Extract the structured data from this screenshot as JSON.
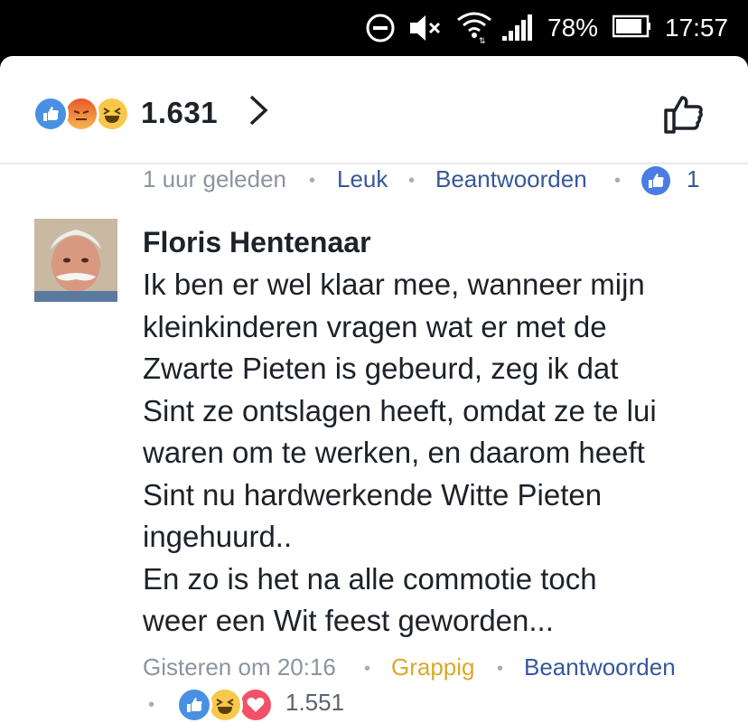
{
  "status_bar": {
    "battery_percent": "78%",
    "time": "17:57",
    "icons": [
      "do-not-disturb-icon",
      "mute-icon",
      "wifi-icon",
      "signal-icon",
      "battery-icon"
    ]
  },
  "reactions_bar": {
    "icons": [
      "like-icon",
      "angry-icon",
      "haha-icon"
    ],
    "count": "1.631"
  },
  "previous_comment_meta": {
    "time": "1 uur geleden",
    "like": "Leuk",
    "reply": "Beantwoorden",
    "like_count": "1"
  },
  "comment": {
    "author": "Floris Hentenaar",
    "lines": [
      "Ik ben er wel klaar mee, wanneer mijn",
      "kleinkinderen vragen wat er met de",
      "Zwarte Pieten is gebeurd, zeg ik dat",
      "Sint ze ontslagen heeft, omdat ze te lui",
      "waren om te werken, en daarom heeft",
      "Sint nu hardwerkende Witte Pieten",
      "ingehuurd..",
      "En zo is het na alle commotie toch",
      "weer een Wit feest geworden..."
    ],
    "time": "Gisteren om 20:16",
    "reaction": "Grappig",
    "reply": "Beantwoorden",
    "reaction_icons": [
      "like-icon",
      "haha-icon",
      "love-icon"
    ],
    "reaction_count": "1.551"
  },
  "colors": {
    "text": "#1d2129",
    "meta_grey": "#8d949e",
    "link_blue": "#365899",
    "funny_gold": "#d7a92c",
    "like_blue": "#4a90e2"
  }
}
